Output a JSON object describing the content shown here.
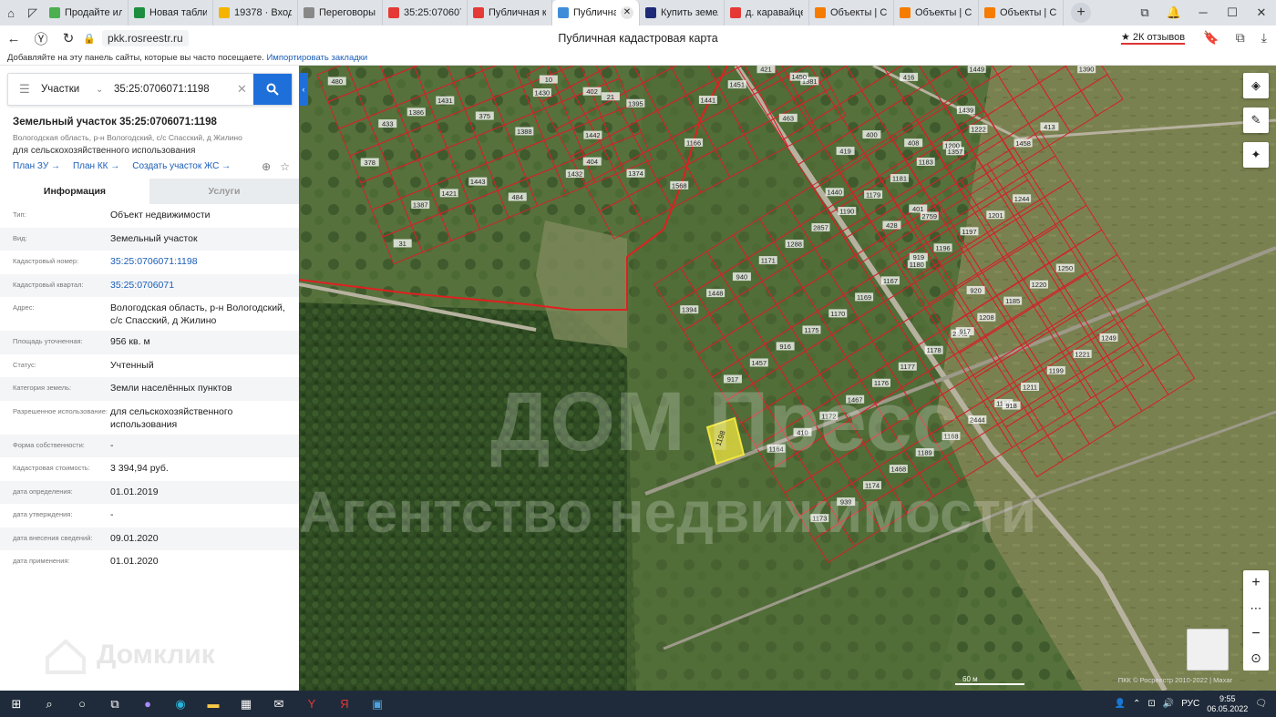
{
  "browser": {
    "tabs": [
      {
        "title": "Продайте или",
        "color": "#4caf50"
      },
      {
        "title": "Новая таблиц",
        "color": "#1e8e3e"
      },
      {
        "title": "19378 · Входя",
        "color": "#f4b400"
      },
      {
        "title": "Переговоры",
        "color": "#888888"
      },
      {
        "title": "35:25:0706071",
        "color": "#e53935"
      },
      {
        "title": "Публичная ка",
        "color": "#e53935"
      },
      {
        "title": "Публичная",
        "color": "#3f8cd9",
        "active": true
      },
      {
        "title": "Купить земел",
        "color": "#1e2a78"
      },
      {
        "title": "д. каравайцев",
        "color": "#e53935"
      },
      {
        "title": "Объекты | CR",
        "color": "#f57c00"
      },
      {
        "title": "Объекты | CR",
        "color": "#f57c00"
      },
      {
        "title": "Объекты | CR",
        "color": "#f57c00"
      }
    ],
    "url": "pkk.rosreestr.ru",
    "page_title": "Публичная кадастровая карта",
    "reviews": "★ 2К отзывов",
    "bookmarks_text": "Добавляйте на эту панель сайты, которые вы часто посещаете.",
    "bookmarks_link": "Импортировать закладки"
  },
  "search": {
    "type": "Участки",
    "value": "35:25:0706071:1198"
  },
  "parcel": {
    "title": "Земельный участок 35:25:0706071:1198",
    "address_short": "Вологодская область, р-н Вологодский, с/с Спасский, д Жилино",
    "purpose": "для сельскохозяйственного использования",
    "links": [
      "План ЗУ →",
      "План КК →",
      "Создать участок ЖС →"
    ]
  },
  "info_tabs": {
    "info": "Информация",
    "services": "Услуги"
  },
  "properties": [
    {
      "label": "Тип:",
      "value": "Объект недвижимости"
    },
    {
      "label": "Вид:",
      "value": "Земельный участок"
    },
    {
      "label": "Кадастровый номер:",
      "value": "35:25:0706071:1198",
      "link": true
    },
    {
      "label": "Кадастровый квартал:",
      "value": "35:25:0706071",
      "link": true
    },
    {
      "label": "Адрес:",
      "value": "Вологодская область, р-н Вологодский, с/с Спасский, д Жилино"
    },
    {
      "label": "Площадь уточненная:",
      "value": "956 кв. м"
    },
    {
      "label": "Статус:",
      "value": "Учтенный"
    },
    {
      "label": "Категория земель:",
      "value": "Земли населённых пунктов"
    },
    {
      "label": "Разрешенное использование:",
      "value": "для сельскохозяйственного использования"
    },
    {
      "label": "Форма собственности:",
      "value": "-"
    },
    {
      "label": "Кадастровая стоимость:",
      "value": "3 394,94 руб."
    },
    {
      "label": "дата определения:",
      "value": "01.01.2019"
    },
    {
      "label": "дата утверждения:",
      "value": "-"
    },
    {
      "label": "дата внесения сведений:",
      "value": "09.01.2020"
    },
    {
      "label": "дата применения:",
      "value": "01.01.2020"
    }
  ],
  "watermark_panel": "Домклик",
  "map": {
    "watermark_line1": "ДОМ Пресс",
    "watermark_line2": "Агентство недвижимости",
    "scale": "60 м",
    "copyright": "ПКК © Росреестр 2010-2022 | Maxar",
    "selected_label": "1198",
    "labels": [
      "480",
      "378",
      "31",
      "433",
      "1387",
      "1386",
      "1421",
      "1431",
      "1443",
      "375",
      "484",
      "1388",
      "1430",
      "1432",
      "1442",
      "21",
      "10",
      "404",
      "402",
      "1374",
      "1395",
      "1568",
      "1166",
      "1441",
      "1451",
      "421",
      "1381",
      "463",
      "1440",
      "1450",
      "419",
      "428",
      "400",
      "401",
      "408",
      "416",
      "1357",
      "1439",
      "1449",
      "1458",
      "413",
      "1390",
      "1394",
      "917",
      "1164",
      "1173",
      "1448",
      "1457",
      "410",
      "939",
      "940",
      "916",
      "1172",
      "1174",
      "1171",
      "1175",
      "1467",
      "1468",
      "1288",
      "1170",
      "1176",
      "1189",
      "2857",
      "1169",
      "1177",
      "1168",
      "1190",
      "1167",
      "1178",
      "2444",
      "1179",
      "1180",
      "2445",
      "1184",
      "1181",
      "1196",
      "1208",
      "1211",
      "1183",
      "1197",
      "1185",
      "1199",
      "1200",
      "1201",
      "1220",
      "1221",
      "1222",
      "1244",
      "1250",
      "1249",
      "919",
      "917",
      "918",
      "2759",
      "920"
    ]
  },
  "map_tools": {
    "layers_icon": "layers-icon",
    "ruler_icon": "ruler-icon",
    "locate_icon": "locate-icon",
    "zoom_in": "+",
    "more": "⋯",
    "zoom_out": "−"
  },
  "taskbar": {
    "lang": "РУС",
    "time": "9:55",
    "date": "06.05.2022"
  }
}
